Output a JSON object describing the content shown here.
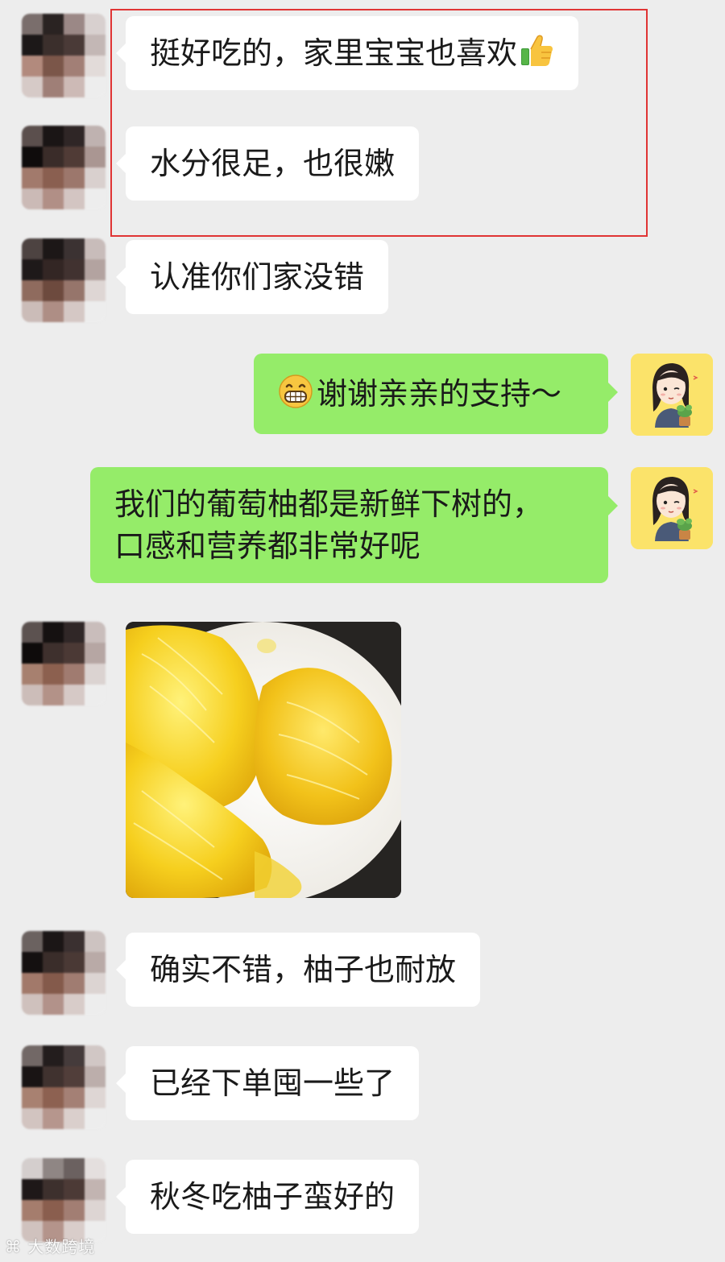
{
  "messages": [
    {
      "side": "left",
      "text": "挺好吃的，家里宝宝也喜欢",
      "emoji": "thumbs-up"
    },
    {
      "side": "left",
      "text": "水分很足，也很嫩"
    },
    {
      "side": "left",
      "text": "认准你们家没错"
    },
    {
      "side": "right",
      "text": "谢谢亲亲的支持～",
      "emoji": "grinning-face"
    },
    {
      "side": "right",
      "line1": "我们的葡萄柚都是新鲜下树的，",
      "line2": "口感和营养都非常好呢"
    },
    {
      "side": "left",
      "type": "image",
      "alt": "grapefruit-pulp-photo"
    },
    {
      "side": "left",
      "text": "确实不错，柚子也耐放"
    },
    {
      "side": "left",
      "text": "已经下单囤一些了"
    },
    {
      "side": "left",
      "text": "秋冬吃柚子蛮好的"
    }
  ],
  "watermark": "大数跨境",
  "colors": {
    "background": "#ededed",
    "left_bubble": "#ffffff",
    "right_bubble": "#95ec69",
    "highlight": "#e03434"
  }
}
